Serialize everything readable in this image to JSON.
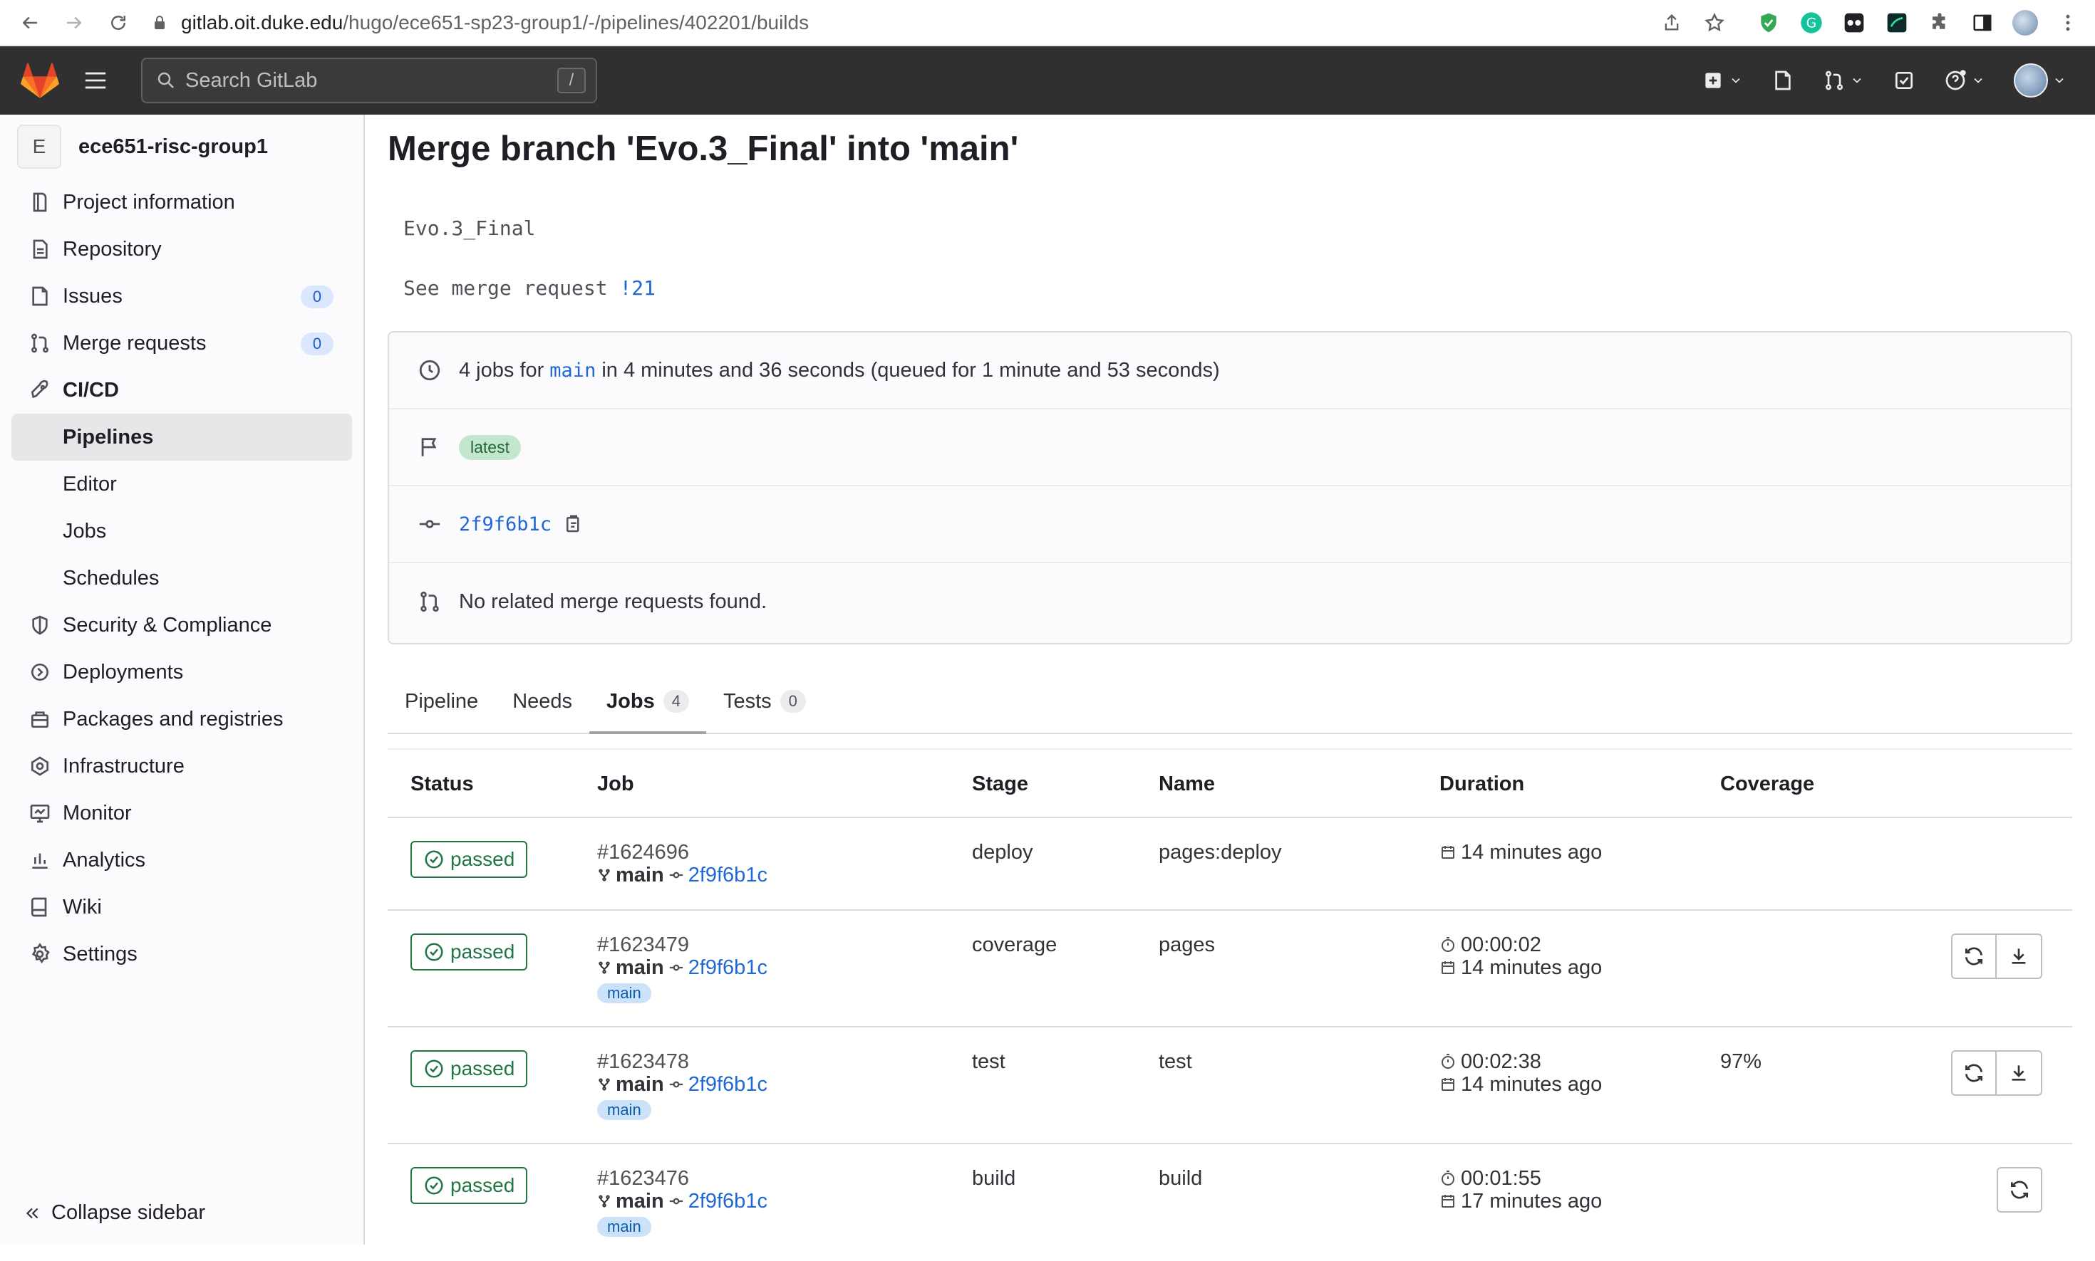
{
  "browser": {
    "url_host": "gitlab.oit.duke.edu",
    "url_path": "/hugo/ece651-sp23-group1/-/pipelines/402201/builds"
  },
  "topbar": {
    "search_placeholder": "Search GitLab",
    "search_shortcut": "/"
  },
  "sidebar": {
    "project_initial": "E",
    "project_name": "ece651-risc-group1",
    "items": [
      {
        "label": "Project information",
        "icon": "project-icon"
      },
      {
        "label": "Repository",
        "icon": "document-icon"
      },
      {
        "label": "Issues",
        "icon": "issues-icon",
        "count": "0"
      },
      {
        "label": "Merge requests",
        "icon": "merge-request-icon",
        "count": "0"
      },
      {
        "label": "CI/CD",
        "icon": "rocket-icon"
      },
      {
        "label": "Pipelines"
      },
      {
        "label": "Editor"
      },
      {
        "label": "Jobs"
      },
      {
        "label": "Schedules"
      },
      {
        "label": "Security & Compliance",
        "icon": "shield-icon"
      },
      {
        "label": "Deployments",
        "icon": "deployments-icon"
      },
      {
        "label": "Packages and registries",
        "icon": "package-icon"
      },
      {
        "label": "Infrastructure",
        "icon": "cloud-icon"
      },
      {
        "label": "Monitor",
        "icon": "monitor-icon"
      },
      {
        "label": "Analytics",
        "icon": "chart-icon"
      },
      {
        "label": "Wiki",
        "icon": "book-icon"
      },
      {
        "label": "Settings",
        "icon": "gear-icon"
      }
    ],
    "collapse_label": "Collapse sidebar"
  },
  "pipeline": {
    "title": "Merge branch 'Evo.3_Final' into 'main'",
    "desc_line1": "Evo.3_Final",
    "desc_line2_prefix": "See merge request ",
    "desc_line2_link": "!21",
    "summary_prefix": "4 jobs for ",
    "summary_ref": "main",
    "summary_suffix": " in 4 minutes and 36 seconds (queued for 1 minute and 53 seconds)",
    "badge": "latest",
    "commit_sha": "2f9f6b1c",
    "mr_text": "No related merge requests found."
  },
  "tabs": [
    {
      "label": "Pipeline"
    },
    {
      "label": "Needs"
    },
    {
      "label": "Jobs",
      "count": "4"
    },
    {
      "label": "Tests",
      "count": "0"
    }
  ],
  "table": {
    "headers": [
      "Status",
      "Job",
      "Stage",
      "Name",
      "Duration",
      "Coverage"
    ],
    "rows": [
      {
        "status": "passed",
        "id": "#1624696",
        "ref": "main",
        "sha": "2f9f6b1c",
        "badge": "",
        "stage": "deploy",
        "name": "pages:deploy",
        "duration": "",
        "finished": "14 minutes ago",
        "coverage": ""
      },
      {
        "status": "passed",
        "id": "#1623479",
        "ref": "main",
        "sha": "2f9f6b1c",
        "badge": "main",
        "stage": "coverage",
        "name": "pages",
        "duration": "00:00:02",
        "finished": "14 minutes ago",
        "coverage": ""
      },
      {
        "status": "passed",
        "id": "#1623478",
        "ref": "main",
        "sha": "2f9f6b1c",
        "badge": "main",
        "stage": "test",
        "name": "test",
        "duration": "00:02:38",
        "finished": "14 minutes ago",
        "coverage": "97%"
      },
      {
        "status": "passed",
        "id": "#1623476",
        "ref": "main",
        "sha": "2f9f6b1c",
        "badge": "main",
        "stage": "build",
        "name": "build",
        "duration": "00:01:55",
        "finished": "17 minutes ago",
        "coverage": ""
      }
    ]
  },
  "colors": {
    "topbar": "#303030",
    "success": "#217645",
    "link": "#1f68d6"
  }
}
